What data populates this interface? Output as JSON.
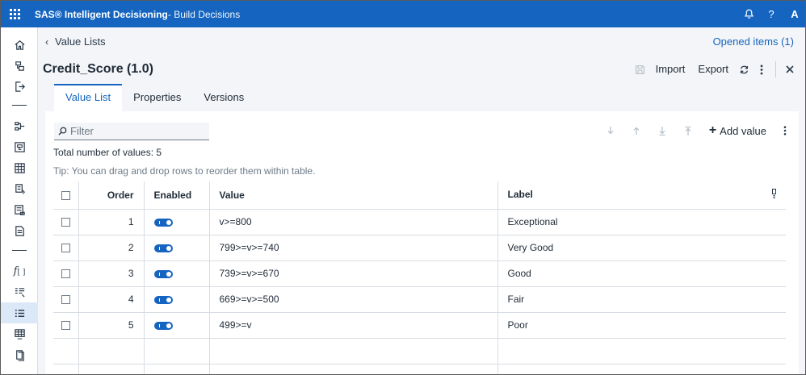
{
  "colors": {
    "brand": "#1565c0",
    "active_nav_bg": "#dbe8f7"
  },
  "topbar": {
    "brand_bold": "SAS® Intelligent Decisioning",
    "brand_rest": " - Build Decisions",
    "icons": [
      "apps-icon",
      "notification-bell-icon",
      "help-icon"
    ],
    "help_glyph": "?",
    "avatar_initial": "A"
  },
  "leftnav": {
    "items": [
      "home-icon",
      "business-objects-icon",
      "export-icon",
      "decisions-icon",
      "flows-icon",
      "tables-icon",
      "rule-sets-icon",
      "models-icon",
      "code-files-icon",
      "functions-icon",
      "treatments-icon",
      "value-lists-icon",
      "lookup-tables-icon",
      "documents-icon"
    ],
    "active": "value-lists-icon"
  },
  "breadcrumb": {
    "label": "Value Lists"
  },
  "opened_items": "Opened items (1)",
  "page": {
    "title": "Credit_Score (1.0)"
  },
  "actions": {
    "import": "Import",
    "export": "Export"
  },
  "tabs": [
    {
      "label": "Value List",
      "active": true
    },
    {
      "label": "Properties",
      "active": false
    },
    {
      "label": "Versions",
      "active": false
    }
  ],
  "filter": {
    "placeholder": "Filter",
    "value": ""
  },
  "toolbar": {
    "add_value": "Add value"
  },
  "summary": {
    "total": "Total number of values: 5",
    "tip": "Tip: You can drag and drop rows to reorder them within table."
  },
  "table": {
    "headers": {
      "order": "Order",
      "enabled": "Enabled",
      "value": "Value",
      "label": "Label"
    },
    "rows": [
      {
        "order": "1",
        "enabled": true,
        "value": "v>=800",
        "label": "Exceptional"
      },
      {
        "order": "2",
        "enabled": true,
        "value": "799>=v>=740",
        "label": "Very Good"
      },
      {
        "order": "3",
        "enabled": true,
        "value": "739>=v>=670",
        "label": "Good"
      },
      {
        "order": "4",
        "enabled": true,
        "value": "669>=v>=500",
        "label": "Fair"
      },
      {
        "order": "5",
        "enabled": true,
        "value": "499>=v",
        "label": "Poor"
      }
    ]
  }
}
